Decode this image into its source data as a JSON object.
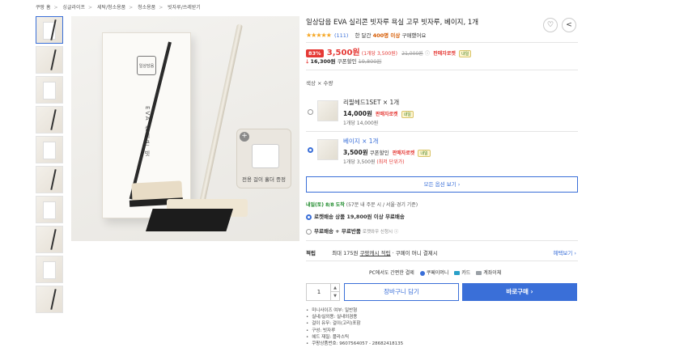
{
  "breadcrumb": [
    "쿠팡 홈",
    "싱글라이프",
    "세탁/청소용품",
    "청소용품",
    "빗자루/쓰레받기"
  ],
  "product": {
    "title": "일상담음 EVA 실리콘 빗자루 욕실 고무 빗자루, 베이지, 1개",
    "box_logo": "일상담음",
    "box_vertical_text": "EVA 실리콘 빗",
    "holder_label": "전용 걸이 홀더 증정",
    "holder_plus": "+"
  },
  "actions": {
    "wish_icon": "heart-icon",
    "share_icon": "share-icon",
    "wish_glyph": "♡",
    "share_glyph": "<"
  },
  "rating": {
    "stars": "★★★★★",
    "count": "(111)",
    "sold_prefix": "한 달간",
    "sold_count": "400명 이상",
    "sold_suffix": "구매했어요"
  },
  "price": {
    "discount": "83%",
    "value": "3,500원",
    "unit": "(1개당 3,500원)",
    "original": "21,000원",
    "info_glyph": "ⓘ",
    "rocket": "판매자로켓",
    "tag": "내일",
    "coupon_arrow": "🡓",
    "coupon_price": "16,300원",
    "coupon_label": "쿠폰할인",
    "coupon_strike": "19,800원"
  },
  "options": {
    "label": "색상 × 수량",
    "items": [
      {
        "name": "리필헤드1SET × 1개",
        "price": "14,000원",
        "coupon": "",
        "rocket": "판매자로켓",
        "tag": "내일",
        "unit": "1개당 14,000원",
        "extra": ""
      },
      {
        "name": "베이지 × 1개",
        "price": "3,500원",
        "coupon": "쿠폰할인",
        "rocket": "판매자로켓",
        "tag": "내일",
        "unit": "1개당 3,500원",
        "extra": "(최저 단위가)"
      }
    ],
    "more": "모든 옵션 보기 ›"
  },
  "delivery": {
    "date": "내일(토) 8/8 도착",
    "note": "(57분 내 주문 시 / 서울·경기 기준)",
    "opt1": "로켓배송 상품 19,800원 이상 무료배송",
    "opt2": "무료배송 + 무료반품",
    "opt2_note": "로켓와우 신청시 ⓘ"
  },
  "benefit": {
    "label": "적립",
    "text_a": "최대 175원",
    "text_b": "쿠팡캐시 적립",
    "text_c": "· 쿠페이 머니 결제시",
    "more": "혜택보기 ›"
  },
  "pay": {
    "text": "PC에서도 간편한 결제",
    "m1": "쿠페이머니",
    "m2": "카드",
    "m3": "계좌이체",
    "m1_color": "#3a6fd8",
    "m2_color": "#2aa0c8",
    "m3_color": "#9aa0a6"
  },
  "purchase": {
    "qty": "1",
    "up": "▲",
    "down": "▼",
    "cart": "장바구니 담기",
    "buy": "바로구매  ›"
  },
  "specs": [
    "미니사이즈 여부: 일반형",
    "실내/실외용: 실내외겸용",
    "걸이 유무: 걸이(고리)포함",
    "구성: 빗자루",
    "헤드 재질: 플라스틱",
    "쿠팡상품번호: 9607564057 - 28682418135"
  ],
  "colors": {
    "accent": "#3a6fd8",
    "price_red": "#e53935",
    "star": "#f5a623",
    "green": "#1d8a2a"
  }
}
